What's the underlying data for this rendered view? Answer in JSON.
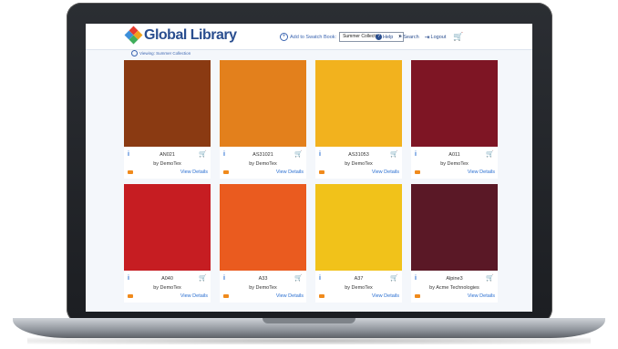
{
  "header": {
    "logo_text": "Global Library",
    "add_label": "Add to Swatch Book:",
    "collection_selected": "Summer Collection",
    "help_label": "Help",
    "search_label": "Search",
    "logout_label": "Logout"
  },
  "viewing_label": "Viewing: Summer Collection",
  "cards": [
    {
      "code": "AN021",
      "maker": "by DemoTex",
      "details": "View Details",
      "color": "#8a3a12"
    },
    {
      "code": "AS31021",
      "maker": "by DemoTex",
      "details": "View Details",
      "color": "#e3801c"
    },
    {
      "code": "AS31053",
      "maker": "by DemoTex",
      "details": "View Details",
      "color": "#f2b21e"
    },
    {
      "code": "A011",
      "maker": "by DemoTex",
      "details": "View Details",
      "color": "#7e1524"
    },
    {
      "code": "A040",
      "maker": "by DemoTex",
      "details": "View Details",
      "color": "#c61d22"
    },
    {
      "code": "A33",
      "maker": "by DemoTex",
      "details": "View Details",
      "color": "#ea5b1f"
    },
    {
      "code": "A37",
      "maker": "by DemoTex",
      "details": "View Details",
      "color": "#f1c21a"
    },
    {
      "code": "Alpine3",
      "maker": "by Acme Technologies",
      "details": "View Details",
      "color": "#5a1826"
    }
  ]
}
